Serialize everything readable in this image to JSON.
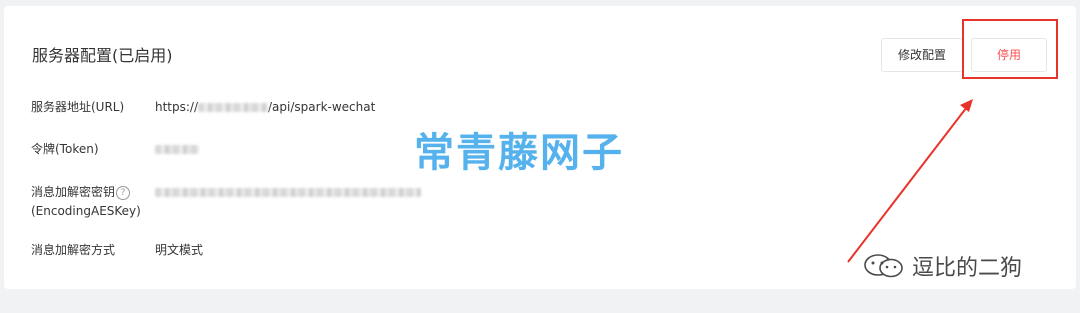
{
  "panel": {
    "title": "服务器配置(已启用)",
    "modify_button": "修改配置",
    "disable_button": "停用"
  },
  "fields": [
    {
      "label": "服务器地址(URL)",
      "value_prefix": "https://",
      "value_suffix": "/api/spark-wechat"
    },
    {
      "label": "令牌(Token)"
    },
    {
      "label_line1": "消息加解密密钥",
      "help_icon": "?",
      "label_line2": "(EncodingAESKey)"
    },
    {
      "label": "消息加解密方式",
      "value": "明文模式"
    }
  ],
  "watermark": {
    "text": "常青藤网子"
  },
  "signature": {
    "text": "逗比的二狗",
    "icon": "wechat-icon"
  },
  "colors": {
    "accent_red": "#fa5151",
    "annotation_red": "#e8332a",
    "watermark_blue": "#44aaea"
  }
}
